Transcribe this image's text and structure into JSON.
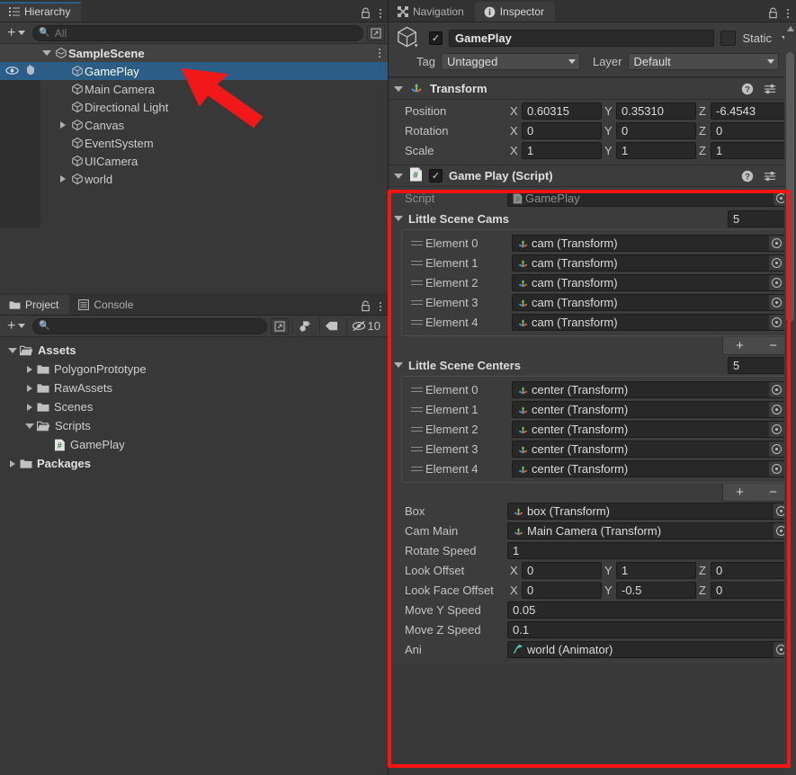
{
  "hierarchy": {
    "tab_label": "Hierarchy",
    "search_placeholder": "All",
    "add_label": "+",
    "scene_name": "SampleScene",
    "items": [
      {
        "label": "GamePlay",
        "indent": 2,
        "expandable": false,
        "selected": true
      },
      {
        "label": "Main Camera",
        "indent": 2,
        "expandable": false,
        "selected": false
      },
      {
        "label": "Directional Light",
        "indent": 2,
        "expandable": false,
        "selected": false
      },
      {
        "label": "Canvas",
        "indent": 2,
        "expandable": true,
        "selected": false
      },
      {
        "label": "EventSystem",
        "indent": 2,
        "expandable": false,
        "selected": false
      },
      {
        "label": "UICamera",
        "indent": 2,
        "expandable": false,
        "selected": false
      },
      {
        "label": "world",
        "indent": 2,
        "expandable": true,
        "selected": false
      }
    ]
  },
  "project": {
    "tab_label": "Project",
    "console_tab_label": "Console",
    "search_placeholder": "",
    "hidden_count": "10",
    "tree": [
      {
        "label": "Assets",
        "indent": 0,
        "expanded": true,
        "expandable": true,
        "type": "folder-open",
        "bold": true
      },
      {
        "label": "PolygonPrototype",
        "indent": 1,
        "expanded": false,
        "expandable": true,
        "type": "folder",
        "bold": false
      },
      {
        "label": "RawAssets",
        "indent": 1,
        "expanded": false,
        "expandable": true,
        "type": "folder",
        "bold": false
      },
      {
        "label": "Scenes",
        "indent": 1,
        "expanded": false,
        "expandable": true,
        "type": "folder",
        "bold": false
      },
      {
        "label": "Scripts",
        "indent": 1,
        "expanded": true,
        "expandable": true,
        "type": "folder-open",
        "bold": false
      },
      {
        "label": "GamePlay",
        "indent": 2,
        "expanded": false,
        "expandable": false,
        "type": "cs-script",
        "bold": false
      },
      {
        "label": "Packages",
        "indent": 0,
        "expanded": false,
        "expandable": true,
        "type": "folder",
        "bold": true
      }
    ]
  },
  "inspector": {
    "navigation_tab_label": "Navigation",
    "inspector_tab_label": "Inspector",
    "object_name": "GamePlay",
    "enabled": true,
    "static_label": "Static",
    "tag_label": "Tag",
    "tag_value": "Untagged",
    "layer_label": "Layer",
    "layer_value": "Default",
    "transform": {
      "title": "Transform",
      "rows": [
        {
          "label": "Position",
          "x": "0.60315",
          "y": "0.35310",
          "z": "-6.4543"
        },
        {
          "label": "Rotation",
          "x": "0",
          "y": "0",
          "z": "0"
        },
        {
          "label": "Scale",
          "x": "1",
          "y": "1",
          "z": "1"
        }
      ]
    },
    "gameplay_script": {
      "title": "Game Play (Script)",
      "enabled": true,
      "script_label": "Script",
      "script_value": "GamePlay",
      "arrays": [
        {
          "title": "Little Scene Cams",
          "size": "5",
          "elements": [
            {
              "label": "Element 0",
              "value": "cam (Transform)"
            },
            {
              "label": "Element 1",
              "value": "cam (Transform)"
            },
            {
              "label": "Element 2",
              "value": "cam (Transform)"
            },
            {
              "label": "Element 3",
              "value": "cam (Transform)"
            },
            {
              "label": "Element 4",
              "value": "cam (Transform)"
            }
          ],
          "add_label": "+",
          "remove_label": "−"
        },
        {
          "title": "Little Scene Centers",
          "size": "5",
          "elements": [
            {
              "label": "Element 0",
              "value": "center (Transform)"
            },
            {
              "label": "Element 1",
              "value": "center (Transform)"
            },
            {
              "label": "Element 2",
              "value": "center (Transform)"
            },
            {
              "label": "Element 3",
              "value": "center (Transform)"
            },
            {
              "label": "Element 4",
              "value": "center (Transform)"
            }
          ],
          "add_label": "+",
          "remove_label": "−"
        }
      ],
      "fields": [
        {
          "kind": "object",
          "label": "Box",
          "value": "box (Transform)",
          "icon": "transform-icon"
        },
        {
          "kind": "object",
          "label": "Cam Main",
          "value": "Main Camera (Transform)",
          "icon": "transform-icon"
        },
        {
          "kind": "number",
          "label": "Rotate Speed",
          "value": "1"
        },
        {
          "kind": "vector",
          "label": "Look Offset",
          "x": "0",
          "y": "1",
          "z": "0"
        },
        {
          "kind": "vector",
          "label": "Look Face Offset",
          "x": "0",
          "y": "-0.5",
          "z": "0"
        },
        {
          "kind": "number",
          "label": "Move Y Speed",
          "value": "0.05"
        },
        {
          "kind": "number",
          "label": "Move Z Speed",
          "value": "0.1"
        },
        {
          "kind": "object",
          "label": "Ani",
          "value": "world (Animator)",
          "icon": "animator-icon"
        }
      ]
    }
  },
  "annotation": {
    "highlight_color": "#fe1313",
    "arrow_color": "#fe1313",
    "target": "GamePlay"
  }
}
